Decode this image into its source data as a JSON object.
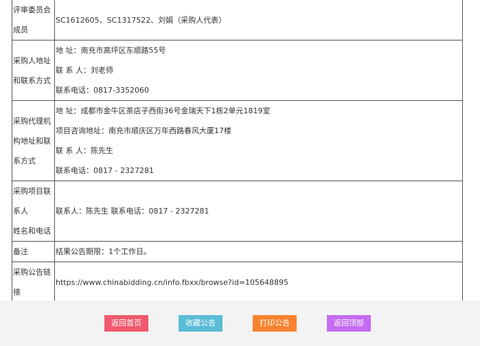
{
  "rows": [
    {
      "label_lines": [
        "评审委员会",
        "成员"
      ],
      "value_lines": [
        "SC1612605、SC1317522、刘娟（采购人代表）"
      ]
    },
    {
      "label_lines": [
        "采购人地址",
        "和联系方式"
      ],
      "value_lines": [
        "地 址：南充市高坪区东顺路55号",
        "联 系 人：刘老师",
        "联系电话：0817-3352060"
      ]
    },
    {
      "label_lines": [
        "采购代理机",
        "构地址和联",
        "系方式"
      ],
      "value_lines": [
        "地 址：成都市金牛区茶店子西街36号金瑞天下1栋2单元1819室",
        "项目咨询地址：南充市顺庆区万年西路春风大厦17楼",
        "联 系 人：陈先生",
        "联系电话：0817 - 2327281"
      ]
    },
    {
      "label_lines": [
        "采购项目联",
        "系人",
        "姓名和电话"
      ],
      "value_lines": [
        "联系人：陈先生 联系电话：0817 - 2327281"
      ]
    },
    {
      "label_lines": [
        "备注"
      ],
      "value_lines": [
        "结果公告期限：1个工作日。"
      ]
    },
    {
      "label_lines": [
        "采购公告链",
        "接"
      ],
      "value_lines": [
        "https://www.chinabidding.cn/info.fbxx/browse?id=105648895"
      ]
    }
  ],
  "buttons": {
    "home": "返回首页",
    "favorite": "收藏公告",
    "print": "打印公告",
    "top": "返回顶部"
  },
  "colors": {
    "home": "#f05a6e",
    "favorite": "#5bbcd6",
    "print": "#f7822e",
    "top": "#c36bf2"
  }
}
